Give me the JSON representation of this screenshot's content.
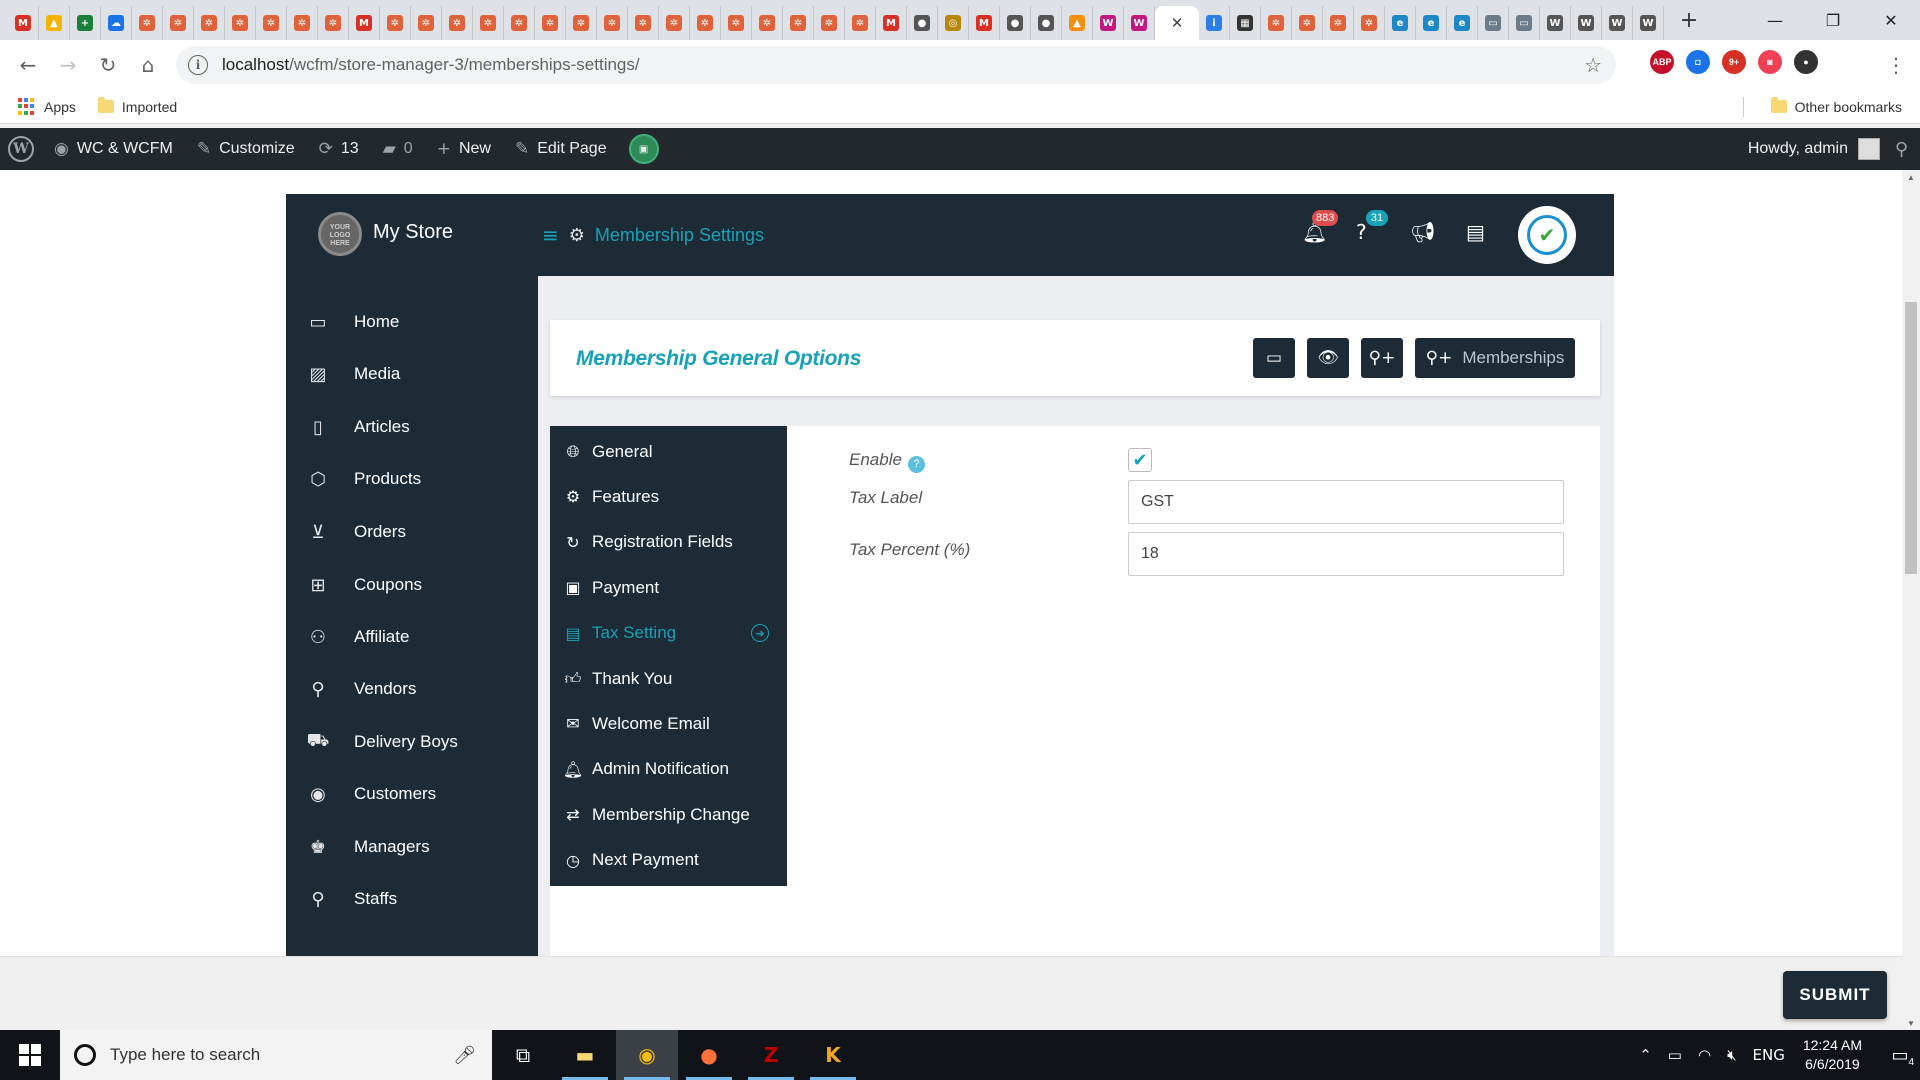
{
  "browser": {
    "tab_favicons": [
      {
        "icon": "gmail-icon",
        "glyph": "M",
        "color": "#d93025"
      },
      {
        "icon": "drive-icon",
        "glyph": "▲",
        "color": "#f4b400"
      },
      {
        "icon": "sheets-icon",
        "glyph": "+",
        "color": "#188038"
      },
      {
        "icon": "cloud-icon",
        "glyph": "☁",
        "color": "#1a73e8"
      },
      {
        "icon": "site-icon",
        "glyph": "✲",
        "color": "#e0613a"
      },
      {
        "icon": "site-icon",
        "glyph": "✲",
        "color": "#e0613a"
      },
      {
        "icon": "site-icon",
        "glyph": "✲",
        "color": "#e0613a"
      },
      {
        "icon": "site-icon",
        "glyph": "✲",
        "color": "#e0613a"
      },
      {
        "icon": "site-icon",
        "glyph": "✲",
        "color": "#e0613a"
      },
      {
        "icon": "site-icon",
        "glyph": "✲",
        "color": "#e0613a"
      },
      {
        "icon": "site-icon",
        "glyph": "✲",
        "color": "#e0613a"
      },
      {
        "icon": "gmail-icon",
        "glyph": "M",
        "color": "#d93025"
      },
      {
        "icon": "site-icon",
        "glyph": "✲",
        "color": "#e0613a"
      },
      {
        "icon": "site-icon",
        "glyph": "✲",
        "color": "#e0613a"
      },
      {
        "icon": "site-icon",
        "glyph": "✲",
        "color": "#e0613a"
      },
      {
        "icon": "site-icon",
        "glyph": "✲",
        "color": "#e0613a"
      },
      {
        "icon": "site-icon",
        "glyph": "✲",
        "color": "#e0613a"
      },
      {
        "icon": "site-icon",
        "glyph": "✲",
        "color": "#e0613a"
      },
      {
        "icon": "site-icon",
        "glyph": "✲",
        "color": "#e0613a"
      },
      {
        "icon": "site-icon",
        "glyph": "✲",
        "color": "#e0613a"
      },
      {
        "icon": "site-icon",
        "glyph": "✲",
        "color": "#e0613a"
      },
      {
        "icon": "site-icon",
        "glyph": "✲",
        "color": "#e0613a"
      },
      {
        "icon": "site-icon",
        "glyph": "✲",
        "color": "#e0613a"
      },
      {
        "icon": "site-icon",
        "glyph": "✲",
        "color": "#e0613a"
      },
      {
        "icon": "site-icon",
        "glyph": "✲",
        "color": "#e0613a"
      },
      {
        "icon": "site-icon",
        "glyph": "✲",
        "color": "#e0613a"
      },
      {
        "icon": "site-icon",
        "glyph": "✲",
        "color": "#e0613a"
      },
      {
        "icon": "site-icon",
        "glyph": "✲",
        "color": "#e0613a"
      },
      {
        "icon": "gmail-icon",
        "glyph": "M",
        "color": "#d93025"
      },
      {
        "icon": "globe-icon",
        "glyph": "●",
        "color": "#555555"
      },
      {
        "icon": "coin-icon",
        "glyph": "◎",
        "color": "#b8860b"
      },
      {
        "icon": "gmail-icon",
        "glyph": "M",
        "color": "#d93025"
      },
      {
        "icon": "globe-icon",
        "glyph": "●",
        "color": "#555555"
      },
      {
        "icon": "globe-icon",
        "glyph": "●",
        "color": "#555555"
      },
      {
        "icon": "pma-icon",
        "glyph": "▲",
        "color": "#f29111"
      },
      {
        "icon": "woo-icon",
        "glyph": "W",
        "color": "#c2187f"
      },
      {
        "icon": "woo-icon",
        "glyph": "W",
        "color": "#c2187f"
      },
      {
        "icon": "close-icon",
        "glyph": "✕",
        "color": "#444444",
        "active": true
      },
      {
        "icon": "ibb-icon",
        "glyph": "i",
        "color": "#2b7de9"
      },
      {
        "icon": "film-icon",
        "glyph": "▦",
        "color": "#333333"
      },
      {
        "icon": "site-icon",
        "glyph": "✲",
        "color": "#e0613a"
      },
      {
        "icon": "site-icon",
        "glyph": "✲",
        "color": "#e0613a"
      },
      {
        "icon": "site-icon",
        "glyph": "✲",
        "color": "#e0613a"
      },
      {
        "icon": "site-icon",
        "glyph": "✲",
        "color": "#e0613a"
      },
      {
        "icon": "edge-icon",
        "glyph": "e",
        "color": "#1e88c7"
      },
      {
        "icon": "edge-icon",
        "glyph": "e",
        "color": "#1e88c7"
      },
      {
        "icon": "edge-icon",
        "glyph": "e",
        "color": "#1e88c7"
      },
      {
        "icon": "monitor-icon",
        "glyph": "▭",
        "color": "#6b7b8a"
      },
      {
        "icon": "monitor-icon",
        "glyph": "▭",
        "color": "#6b7b8a"
      },
      {
        "icon": "wordpress-icon",
        "glyph": "W",
        "color": "#555555"
      },
      {
        "icon": "wordpress-icon",
        "glyph": "W",
        "color": "#555555"
      },
      {
        "icon": "wordpress-icon",
        "glyph": "W",
        "color": "#555555"
      },
      {
        "icon": "wordpress-icon",
        "glyph": "W",
        "color": "#555555"
      }
    ],
    "url_host": "localhost",
    "url_path": "/wcfm/store-manager-3/memberships-settings/",
    "bookmarks": {
      "apps": "Apps",
      "imported": "Imported",
      "other": "Other bookmarks"
    },
    "extensions": [
      {
        "name": "adblock-icon",
        "label": "ABP",
        "color": "#c70d2c"
      },
      {
        "name": "camera-icon",
        "label": "◘",
        "color": "#1a73e8"
      },
      {
        "name": "tracker-icon",
        "label": "9+",
        "color": "#d93025"
      },
      {
        "name": "pocket-icon",
        "label": "◙",
        "color": "#ef4056"
      },
      {
        "name": "profile-avatar-icon",
        "label": "●",
        "color": "#333333"
      }
    ]
  },
  "wp_admin_bar": {
    "site_name": "WC & WCFM",
    "customize": "Customize",
    "updates_count": "13",
    "comments_count": "0",
    "new_label": "New",
    "edit_page": "Edit Page",
    "howdy": "Howdy, admin"
  },
  "wcfm": {
    "logo_text": "YOUR LOGO HERE",
    "store_name": "My Store",
    "page_title": "Membership Settings",
    "notifications_count": "883",
    "help_count": "31",
    "menu": [
      "Home",
      "Media",
      "Articles",
      "Products",
      "Orders",
      "Coupons",
      "Affiliate",
      "Vendors",
      "Delivery Boys",
      "Customers",
      "Managers",
      "Staffs"
    ],
    "options_title": "Membership General Options",
    "memberships_button": "Memberships",
    "settings_tabs": [
      {
        "label": "General",
        "icon": "globe-icon"
      },
      {
        "label": "Features",
        "icon": "gear-icon"
      },
      {
        "label": "Registration Fields",
        "icon": "refresh-icon"
      },
      {
        "label": "Payment",
        "icon": "money-icon"
      },
      {
        "label": "Tax Setting",
        "icon": "id-card-icon",
        "active": true
      },
      {
        "label": "Thank You",
        "icon": "thumbs-up-icon"
      },
      {
        "label": "Welcome Email",
        "icon": "envelope-icon"
      },
      {
        "label": "Admin Notification",
        "icon": "bell-icon"
      },
      {
        "label": "Membership Change",
        "icon": "retweet-icon"
      },
      {
        "label": "Next Payment",
        "icon": "clock-icon"
      }
    ],
    "form": {
      "enable_label": "Enable",
      "enable_checked": true,
      "tax_label_label": "Tax Label",
      "tax_label_value": "GST",
      "tax_percent_label": "Tax Percent (%)",
      "tax_percent_value": "18"
    },
    "submit": "SUBMIT"
  },
  "taskbar": {
    "search_placeholder": "Type here to search",
    "language": "ENG",
    "time": "12:24 AM",
    "date": "6/6/2019",
    "notification_count": "4"
  },
  "colors": {
    "accent": "#17a2b8",
    "dark": "#1c2b36",
    "badge_red": "#e04b4b"
  }
}
